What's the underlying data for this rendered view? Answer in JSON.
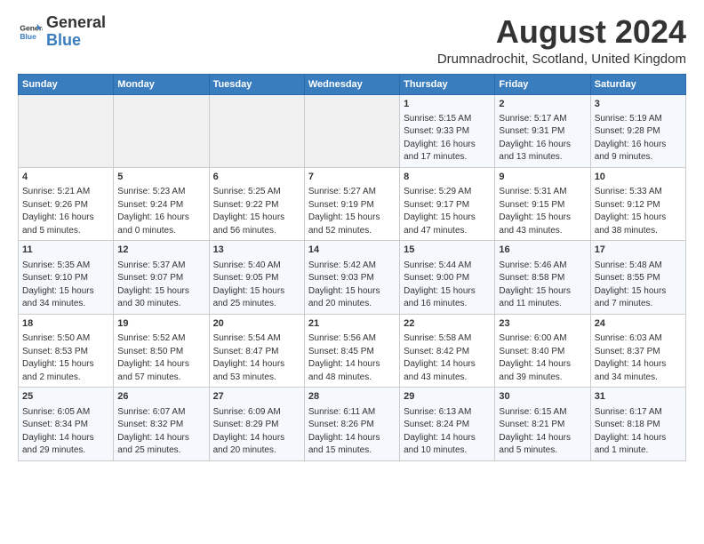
{
  "header": {
    "logo_text_general": "General",
    "logo_text_blue": "Blue",
    "month_title": "August 2024",
    "location": "Drumnadrochit, Scotland, United Kingdom"
  },
  "weekdays": [
    "Sunday",
    "Monday",
    "Tuesday",
    "Wednesday",
    "Thursday",
    "Friday",
    "Saturday"
  ],
  "weeks": [
    [
      {
        "day": "",
        "empty": true
      },
      {
        "day": "",
        "empty": true
      },
      {
        "day": "",
        "empty": true
      },
      {
        "day": "",
        "empty": true
      },
      {
        "day": "1",
        "lines": [
          "Sunrise: 5:15 AM",
          "Sunset: 9:33 PM",
          "Daylight: 16 hours",
          "and 17 minutes."
        ]
      },
      {
        "day": "2",
        "lines": [
          "Sunrise: 5:17 AM",
          "Sunset: 9:31 PM",
          "Daylight: 16 hours",
          "and 13 minutes."
        ]
      },
      {
        "day": "3",
        "lines": [
          "Sunrise: 5:19 AM",
          "Sunset: 9:28 PM",
          "Daylight: 16 hours",
          "and 9 minutes."
        ]
      }
    ],
    [
      {
        "day": "4",
        "lines": [
          "Sunrise: 5:21 AM",
          "Sunset: 9:26 PM",
          "Daylight: 16 hours",
          "and 5 minutes."
        ]
      },
      {
        "day": "5",
        "lines": [
          "Sunrise: 5:23 AM",
          "Sunset: 9:24 PM",
          "Daylight: 16 hours",
          "and 0 minutes."
        ]
      },
      {
        "day": "6",
        "lines": [
          "Sunrise: 5:25 AM",
          "Sunset: 9:22 PM",
          "Daylight: 15 hours",
          "and 56 minutes."
        ]
      },
      {
        "day": "7",
        "lines": [
          "Sunrise: 5:27 AM",
          "Sunset: 9:19 PM",
          "Daylight: 15 hours",
          "and 52 minutes."
        ]
      },
      {
        "day": "8",
        "lines": [
          "Sunrise: 5:29 AM",
          "Sunset: 9:17 PM",
          "Daylight: 15 hours",
          "and 47 minutes."
        ]
      },
      {
        "day": "9",
        "lines": [
          "Sunrise: 5:31 AM",
          "Sunset: 9:15 PM",
          "Daylight: 15 hours",
          "and 43 minutes."
        ]
      },
      {
        "day": "10",
        "lines": [
          "Sunrise: 5:33 AM",
          "Sunset: 9:12 PM",
          "Daylight: 15 hours",
          "and 38 minutes."
        ]
      }
    ],
    [
      {
        "day": "11",
        "lines": [
          "Sunrise: 5:35 AM",
          "Sunset: 9:10 PM",
          "Daylight: 15 hours",
          "and 34 minutes."
        ]
      },
      {
        "day": "12",
        "lines": [
          "Sunrise: 5:37 AM",
          "Sunset: 9:07 PM",
          "Daylight: 15 hours",
          "and 30 minutes."
        ]
      },
      {
        "day": "13",
        "lines": [
          "Sunrise: 5:40 AM",
          "Sunset: 9:05 PM",
          "Daylight: 15 hours",
          "and 25 minutes."
        ]
      },
      {
        "day": "14",
        "lines": [
          "Sunrise: 5:42 AM",
          "Sunset: 9:03 PM",
          "Daylight: 15 hours",
          "and 20 minutes."
        ]
      },
      {
        "day": "15",
        "lines": [
          "Sunrise: 5:44 AM",
          "Sunset: 9:00 PM",
          "Daylight: 15 hours",
          "and 16 minutes."
        ]
      },
      {
        "day": "16",
        "lines": [
          "Sunrise: 5:46 AM",
          "Sunset: 8:58 PM",
          "Daylight: 15 hours",
          "and 11 minutes."
        ]
      },
      {
        "day": "17",
        "lines": [
          "Sunrise: 5:48 AM",
          "Sunset: 8:55 PM",
          "Daylight: 15 hours",
          "and 7 minutes."
        ]
      }
    ],
    [
      {
        "day": "18",
        "lines": [
          "Sunrise: 5:50 AM",
          "Sunset: 8:53 PM",
          "Daylight: 15 hours",
          "and 2 minutes."
        ]
      },
      {
        "day": "19",
        "lines": [
          "Sunrise: 5:52 AM",
          "Sunset: 8:50 PM",
          "Daylight: 14 hours",
          "and 57 minutes."
        ]
      },
      {
        "day": "20",
        "lines": [
          "Sunrise: 5:54 AM",
          "Sunset: 8:47 PM",
          "Daylight: 14 hours",
          "and 53 minutes."
        ]
      },
      {
        "day": "21",
        "lines": [
          "Sunrise: 5:56 AM",
          "Sunset: 8:45 PM",
          "Daylight: 14 hours",
          "and 48 minutes."
        ]
      },
      {
        "day": "22",
        "lines": [
          "Sunrise: 5:58 AM",
          "Sunset: 8:42 PM",
          "Daylight: 14 hours",
          "and 43 minutes."
        ]
      },
      {
        "day": "23",
        "lines": [
          "Sunrise: 6:00 AM",
          "Sunset: 8:40 PM",
          "Daylight: 14 hours",
          "and 39 minutes."
        ]
      },
      {
        "day": "24",
        "lines": [
          "Sunrise: 6:03 AM",
          "Sunset: 8:37 PM",
          "Daylight: 14 hours",
          "and 34 minutes."
        ]
      }
    ],
    [
      {
        "day": "25",
        "lines": [
          "Sunrise: 6:05 AM",
          "Sunset: 8:34 PM",
          "Daylight: 14 hours",
          "and 29 minutes."
        ]
      },
      {
        "day": "26",
        "lines": [
          "Sunrise: 6:07 AM",
          "Sunset: 8:32 PM",
          "Daylight: 14 hours",
          "and 25 minutes."
        ]
      },
      {
        "day": "27",
        "lines": [
          "Sunrise: 6:09 AM",
          "Sunset: 8:29 PM",
          "Daylight: 14 hours",
          "and 20 minutes."
        ]
      },
      {
        "day": "28",
        "lines": [
          "Sunrise: 6:11 AM",
          "Sunset: 8:26 PM",
          "Daylight: 14 hours",
          "and 15 minutes."
        ]
      },
      {
        "day": "29",
        "lines": [
          "Sunrise: 6:13 AM",
          "Sunset: 8:24 PM",
          "Daylight: 14 hours",
          "and 10 minutes."
        ]
      },
      {
        "day": "30",
        "lines": [
          "Sunrise: 6:15 AM",
          "Sunset: 8:21 PM",
          "Daylight: 14 hours",
          "and 5 minutes."
        ]
      },
      {
        "day": "31",
        "lines": [
          "Sunrise: 6:17 AM",
          "Sunset: 8:18 PM",
          "Daylight: 14 hours",
          "and 1 minute."
        ]
      }
    ]
  ]
}
